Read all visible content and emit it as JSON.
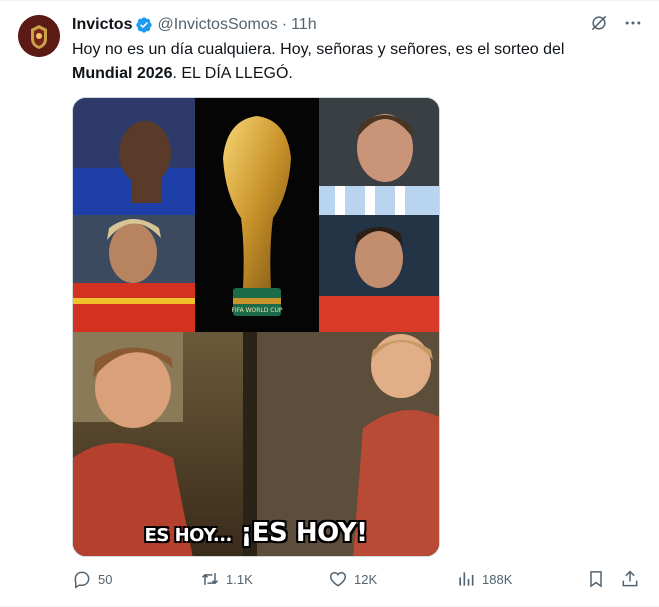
{
  "tweet": {
    "author_name": "Invictos",
    "handle": "@InvictosSomos",
    "separator": "·",
    "time": "11h",
    "text_line1": "Hoy no es un día cualquiera. Hoy, señoras y señores, es el sorteo del",
    "text_bold": "Mundial 2026",
    "text_rest": ". EL DÍA LLEGÓ.",
    "media": {
      "caption_small": "ES HOY...",
      "caption_big": "¡ES HOY!",
      "trophy_text": "FIFA WORLD CUP"
    },
    "stats": {
      "replies": "50",
      "reposts": "1.1K",
      "likes": "12K",
      "views": "188K"
    }
  },
  "icons": {
    "verified": "verified-badge-icon",
    "grok": "grok-icon",
    "more": "more-icon",
    "reply": "reply-icon",
    "repost": "repost-icon",
    "like": "like-icon",
    "views": "views-icon",
    "bookmark": "bookmark-icon",
    "share": "share-icon"
  },
  "colors": {
    "verified": "#1d9bf0",
    "muted": "#536471",
    "text": "#0f1419",
    "avatar": "#5b1a14"
  }
}
